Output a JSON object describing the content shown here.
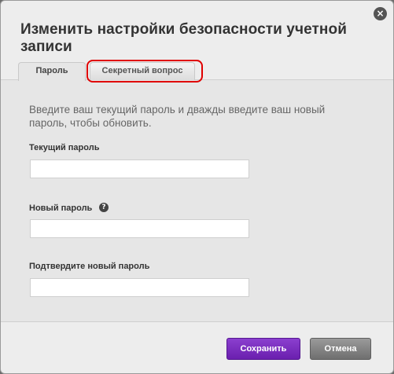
{
  "dialog": {
    "title": "Изменить настройки безопасности учетной записи",
    "close_glyph": "×"
  },
  "tabs": [
    {
      "label": "Пароль",
      "active": true
    },
    {
      "label": "Секретный вопрос",
      "active": false,
      "highlighted": true
    }
  ],
  "instructions": "Введите ваш текущий пароль и дважды введите ваш новый пароль, чтобы обновить.",
  "fields": [
    {
      "label": "Текущий пароль",
      "value": ""
    },
    {
      "label": "Новый пароль",
      "value": "",
      "help_glyph": "?"
    },
    {
      "label": "Подтвердите новый пароль",
      "value": ""
    }
  ],
  "buttons": {
    "save_label": "Сохранить",
    "cancel_label": "Отмена"
  },
  "colors": {
    "save_button": "#7b2fc3",
    "cancel_button": "#858585",
    "highlight_outline": "#e00000"
  }
}
